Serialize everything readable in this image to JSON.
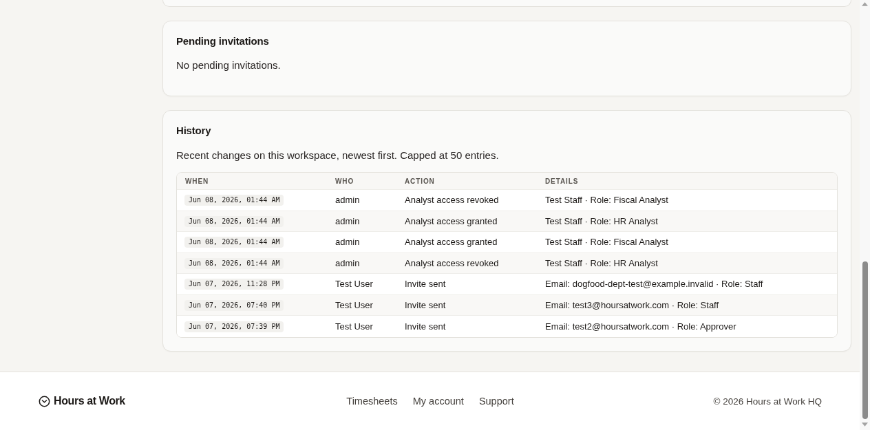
{
  "pending_invitations": {
    "title": "Pending invitations",
    "message": "No pending invitations."
  },
  "history": {
    "title": "History",
    "description": "Recent changes on this workspace, newest first. Capped at 50 entries.",
    "table": {
      "columns": [
        "WHEN",
        "WHO",
        "ACTION",
        "DETAILS"
      ],
      "rows": [
        {
          "when": "Jun 08, 2026, 01:44 AM",
          "who": "admin",
          "action": "Analyst access revoked",
          "details": "Test Staff · Role: Fiscal Analyst"
        },
        {
          "when": "Jun 08, 2026, 01:44 AM",
          "who": "admin",
          "action": "Analyst access granted",
          "details": "Test Staff · Role: HR Analyst"
        },
        {
          "when": "Jun 08, 2026, 01:44 AM",
          "who": "admin",
          "action": "Analyst access granted",
          "details": "Test Staff · Role: Fiscal Analyst"
        },
        {
          "when": "Jun 08, 2026, 01:44 AM",
          "who": "admin",
          "action": "Analyst access revoked",
          "details": "Test Staff · Role: HR Analyst"
        },
        {
          "when": "Jun 07, 2026, 11:28 PM",
          "who": "Test User",
          "action": "Invite sent",
          "details": "Email: dogfood-dept-test@example.invalid · Role: Staff"
        },
        {
          "when": "Jun 07, 2026, 07:40 PM",
          "who": "Test User",
          "action": "Invite sent",
          "details": "Email: test3@hoursatwork.com · Role: Staff"
        },
        {
          "when": "Jun 07, 2026, 07:39 PM",
          "who": "Test User",
          "action": "Invite sent",
          "details": "Email: test2@hoursatwork.com · Role: Approver"
        }
      ]
    }
  },
  "footer": {
    "brand": "Hours at Work",
    "links": [
      "Timesheets",
      "My account",
      "Support"
    ],
    "copyright": "© 2026 Hours at Work HQ"
  }
}
